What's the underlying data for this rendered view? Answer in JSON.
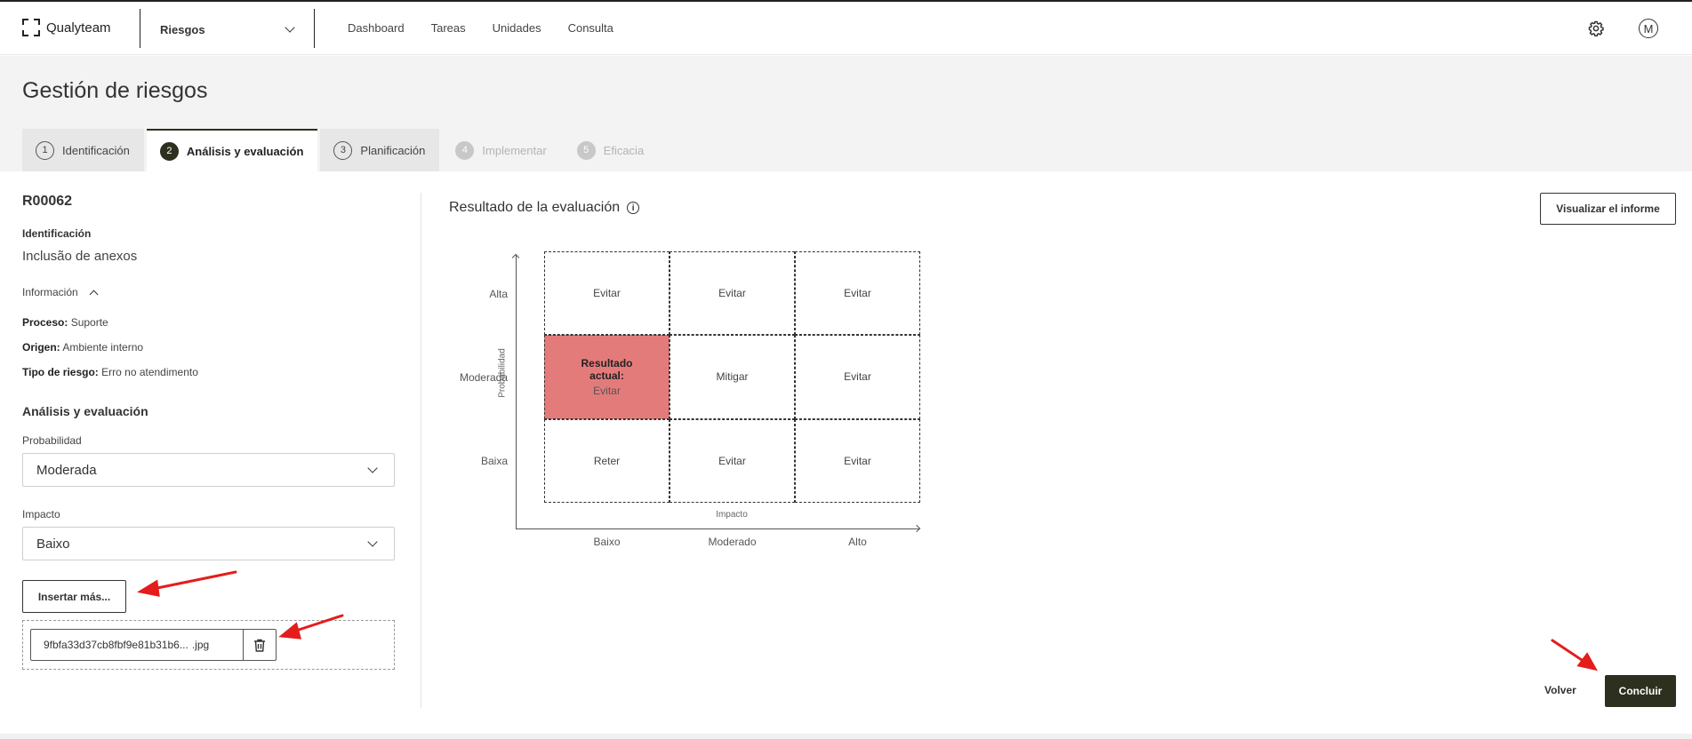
{
  "app": {
    "logo_text": "Qualyteam",
    "module": "Riesgos",
    "nav": [
      "Dashboard",
      "Tareas",
      "Unidades",
      "Consulta"
    ],
    "avatar_initial": "M"
  },
  "page": {
    "title": "Gestión de riesgos",
    "steps": [
      {
        "num": "1",
        "label": "Identificación",
        "state": "done"
      },
      {
        "num": "2",
        "label": "Análisis y evaluación",
        "state": "active"
      },
      {
        "num": "3",
        "label": "Planificación",
        "state": "done"
      },
      {
        "num": "4",
        "label": "Implementar",
        "state": "disabled"
      },
      {
        "num": "5",
        "label": "Eficacia",
        "state": "disabled"
      }
    ]
  },
  "risk": {
    "code": "R00062",
    "identification_label": "Identificación",
    "identification_value": "Inclusão de anexos",
    "info_toggle": "Información",
    "process_label": "Proceso:",
    "process_value": "Suporte",
    "origin_label": "Origen:",
    "origin_value": "Ambiente interno",
    "type_label": "Tipo de riesgo:",
    "type_value": "Erro no atendimento"
  },
  "analysis": {
    "title": "Análisis y evaluación",
    "probability_label": "Probabilidad",
    "probability_value": "Moderada",
    "impact_label": "Impacto",
    "impact_value": "Baixo",
    "insert_more": "Insertar más...",
    "attachment": {
      "name": "9fbfa33d37cb8fbf9e81b31b6...",
      "ext": ".jpg"
    }
  },
  "result": {
    "title": "Resultado de la evaluación",
    "report_button": "Visualizar el informe",
    "y_axis_title": "Probabilidad",
    "x_axis_title": "Impacto",
    "y_labels": [
      "Alta",
      "Moderada",
      "Baixa"
    ],
    "x_labels": [
      "Baixo",
      "Moderado",
      "Alto"
    ],
    "matrix": [
      [
        "Evitar",
        "Evitar",
        "Evitar"
      ],
      [
        "Evitar",
        "Mitigar",
        "Evitar"
      ],
      [
        "Reter",
        "Evitar",
        "Evitar"
      ]
    ],
    "current": {
      "row": 1,
      "col": 0,
      "label": "Resultado actual:",
      "value": "Evitar"
    },
    "current_color": "#e47b7b"
  },
  "footer": {
    "back": "Volver",
    "finish": "Concluir"
  },
  "colors": {
    "primary": "#2d301f",
    "annotation_arrow": "#e51c1c"
  }
}
